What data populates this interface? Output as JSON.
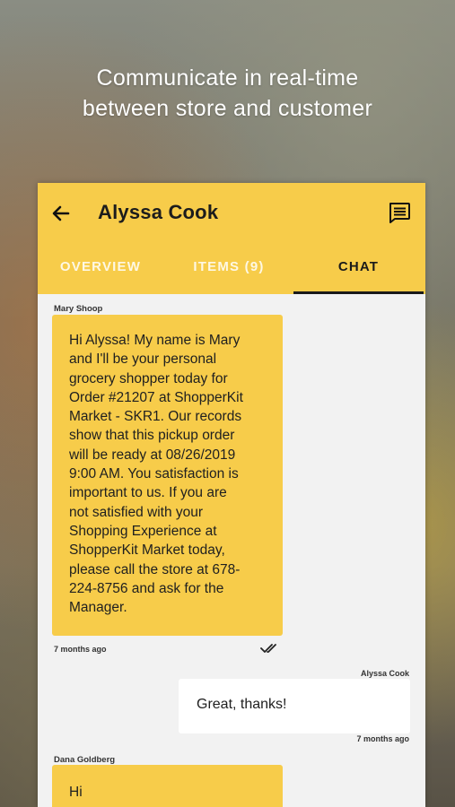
{
  "headline": {
    "line1": "Communicate in real-time",
    "line2": "between store and customer"
  },
  "header": {
    "title": "Alyssa Cook",
    "back_icon": "arrow-left-icon",
    "action_icon": "chat-list-icon"
  },
  "tabs": [
    {
      "label": "OVERVIEW",
      "active": false
    },
    {
      "label": "ITEMS (9)",
      "active": false
    },
    {
      "label": "CHAT",
      "active": true
    }
  ],
  "messages": [
    {
      "sender": "Mary Shoop",
      "direction": "incoming",
      "lines": [
        "Hi Alyssa! My name is Mary",
        "and I'll be your personal",
        "grocery shopper today for",
        "Order #21207 at ShopperKit",
        "Market - SKR1. Our records",
        "show that this pickup order",
        "will be ready at 08/26/2019",
        "9:00 AM. You satisfaction is",
        "important to us. If you are",
        "not satisfied with your",
        "Shopping Experience at",
        "ShopperKit Market today,",
        "please call the store at 678-",
        "224-8756 and ask for the",
        "Manager."
      ],
      "time": "7 months ago",
      "status_icon": "double-check-icon"
    },
    {
      "sender": "Alyssa Cook",
      "direction": "outgoing",
      "text": "Great, thanks!",
      "time": "7 months ago"
    },
    {
      "sender": "Dana Goldberg",
      "direction": "incoming",
      "text": "Hi"
    }
  ],
  "colors": {
    "accent": "#f7cc4a",
    "outgoing_bubble": "#ffffff",
    "chat_background": "#f2f2f2"
  }
}
